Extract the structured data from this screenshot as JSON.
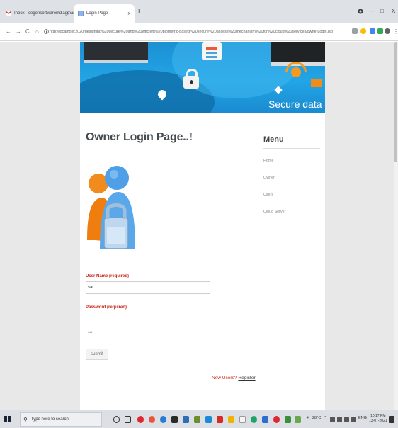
{
  "browser": {
    "tabs": [
      {
        "label": "Inbox - cegonsoftwareindiagmail",
        "close": "x"
      },
      {
        "label": "Login Page",
        "close": "x"
      }
    ],
    "new_tab": "+",
    "window_controls": {
      "minimize": "–",
      "maximize": "□",
      "close": "X"
    },
    "nav": {
      "back": "←",
      "forward": "→",
      "reload": "C",
      "home": "⌂"
    },
    "url": "http://localhost:2020/designing%20secure%20and%20efficient%20biometric-based%20secure%20access%20mechanism%20for%20cloud%20services/ownerLogin.jsp"
  },
  "banner": {
    "text": "Secure data ex"
  },
  "page": {
    "title": "Owner Login Page..!",
    "form": {
      "username_label": "User Name (required)",
      "username_value": "sai",
      "password_label": "Password (required)",
      "password_value": "•••",
      "submit_label": "submit"
    },
    "new_users_text": "New Users?",
    "register_link": "Register"
  },
  "menu": {
    "title": "Menu",
    "items": [
      "Home",
      "Owner",
      "Users",
      "Cloud Server"
    ]
  },
  "taskbar": {
    "search_placeholder": "Type here to search",
    "weather": "28°C",
    "language": "ENG",
    "time": "10:17 PM",
    "date": "13-07-2021"
  },
  "colors": {
    "required_label": "#c9241a",
    "banner_blue": "#1c90d3",
    "tab_strip": "#dee1e6"
  }
}
